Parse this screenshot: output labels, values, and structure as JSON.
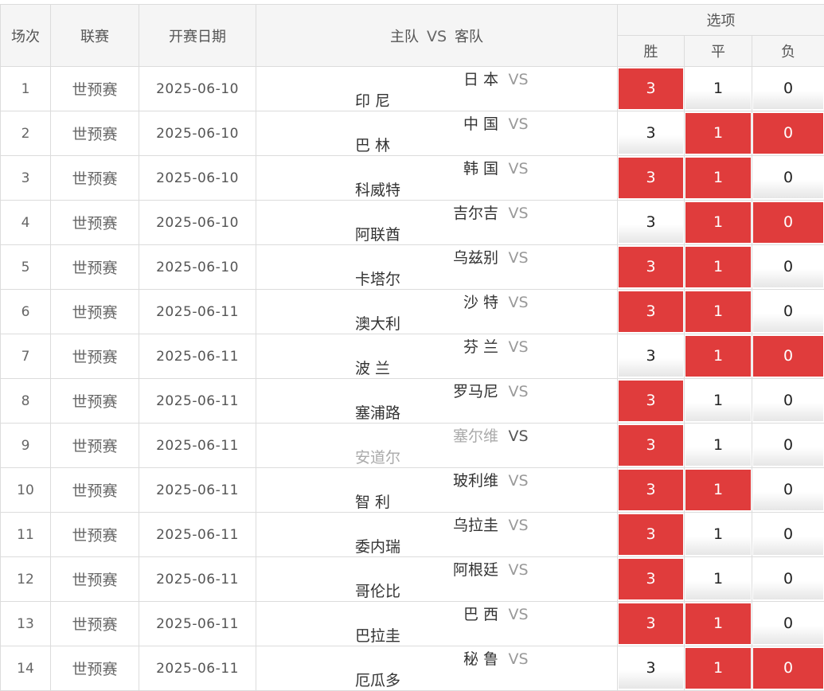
{
  "header": {
    "no": "场次",
    "league": "联赛",
    "date": "开赛日期",
    "home": "主队",
    "vs": "VS",
    "away": "客队",
    "options": "选项",
    "win": "胜",
    "draw": "平",
    "lose": "负"
  },
  "option_values": {
    "win": "3",
    "draw": "1",
    "lose": "0"
  },
  "matches": [
    {
      "no": "1",
      "league": "世预赛",
      "date": "2025-06-10",
      "home": "日 本",
      "away": "印 尼",
      "sel": [
        true,
        false,
        false
      ],
      "muted": false
    },
    {
      "no": "2",
      "league": "世预赛",
      "date": "2025-06-10",
      "home": "中 国",
      "away": "巴 林",
      "sel": [
        false,
        true,
        true
      ],
      "muted": false
    },
    {
      "no": "3",
      "league": "世预赛",
      "date": "2025-06-10",
      "home": "韩 国",
      "away": "科威特",
      "sel": [
        true,
        true,
        false
      ],
      "muted": false
    },
    {
      "no": "4",
      "league": "世预赛",
      "date": "2025-06-10",
      "home": "吉尔吉",
      "away": "阿联酋",
      "sel": [
        false,
        true,
        true
      ],
      "muted": false
    },
    {
      "no": "5",
      "league": "世预赛",
      "date": "2025-06-10",
      "home": "乌兹别",
      "away": "卡塔尔",
      "sel": [
        true,
        true,
        false
      ],
      "muted": false
    },
    {
      "no": "6",
      "league": "世预赛",
      "date": "2025-06-11",
      "home": "沙 特",
      "away": "澳大利",
      "sel": [
        true,
        true,
        false
      ],
      "muted": false
    },
    {
      "no": "7",
      "league": "世预赛",
      "date": "2025-06-11",
      "home": "芬 兰",
      "away": "波 兰",
      "sel": [
        false,
        true,
        true
      ],
      "muted": false
    },
    {
      "no": "8",
      "league": "世预赛",
      "date": "2025-06-11",
      "home": "罗马尼",
      "away": "塞浦路",
      "sel": [
        true,
        false,
        false
      ],
      "muted": false
    },
    {
      "no": "9",
      "league": "世预赛",
      "date": "2025-06-11",
      "home": "塞尔维",
      "away": "安道尔",
      "sel": [
        true,
        false,
        false
      ],
      "muted": true
    },
    {
      "no": "10",
      "league": "世预赛",
      "date": "2025-06-11",
      "home": "玻利维",
      "away": "智 利",
      "sel": [
        true,
        true,
        false
      ],
      "muted": false
    },
    {
      "no": "11",
      "league": "世预赛",
      "date": "2025-06-11",
      "home": "乌拉圭",
      "away": "委内瑞",
      "sel": [
        true,
        false,
        false
      ],
      "muted": false
    },
    {
      "no": "12",
      "league": "世预赛",
      "date": "2025-06-11",
      "home": "阿根廷",
      "away": "哥伦比",
      "sel": [
        true,
        false,
        false
      ],
      "muted": false
    },
    {
      "no": "13",
      "league": "世预赛",
      "date": "2025-06-11",
      "home": "巴 西",
      "away": "巴拉圭",
      "sel": [
        true,
        true,
        false
      ],
      "muted": false
    },
    {
      "no": "14",
      "league": "世预赛",
      "date": "2025-06-11",
      "home": "秘 鲁",
      "away": "厄瓜多",
      "sel": [
        false,
        true,
        true
      ],
      "muted": false
    }
  ],
  "colors": {
    "selected": "#e03c3c",
    "header_bg": "#f5f5f5",
    "border": "#dcdcdc"
  }
}
